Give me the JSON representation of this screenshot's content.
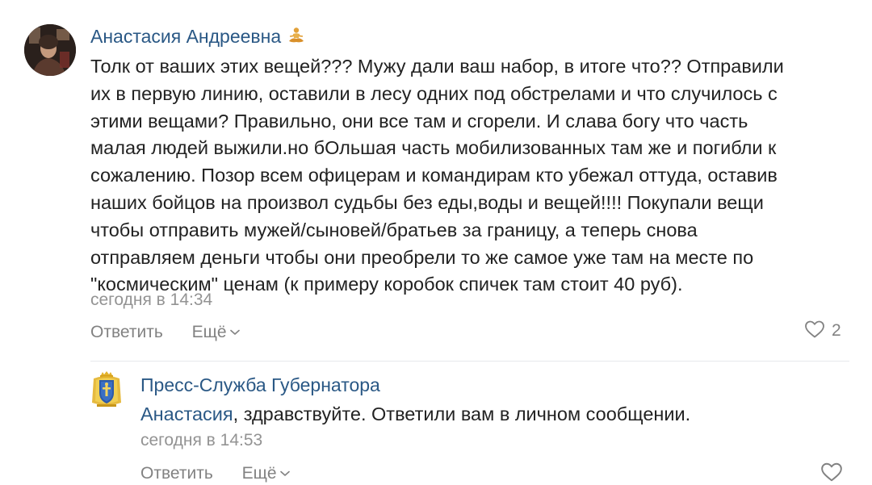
{
  "main_comment": {
    "author": "Анастасия Андреевна",
    "author_emoji": "🧘",
    "text_lines": [
      "Толк от ваших этих вещей??? Мужу дали ваш набор, в итоге что?? Отправили",
      "их в первую линию, оставили в лесу одних под обстрелами и что случилось с",
      "этими вещами? Правильно, они все там и сгорели. И слава богу что часть",
      "малая людей выжили.но бОльшая часть мобилизованных там же и погибли к",
      "сожалению. Позор всем офицерам и командирам кто убежал оттуда, оставив",
      "наших бойцов на произвол судьбы без еды,воды и вещей!!!! Покупали вещи",
      "чтобы отправить мужей/сыновей/братьев за границу, а теперь снова",
      "отправляем деньги чтобы они преобрели то же самое уже там на месте по",
      "\"космическим\" ценам (к примеру коробок спичек там стоит 40 руб)."
    ],
    "timestamp": "сегодня в 14:34",
    "reply_label": "Ответить",
    "more_label": "Ещё",
    "likes": "2",
    "icons": {
      "avatar": "user-avatar",
      "like": "heart-icon",
      "more": "chevron-down-icon"
    }
  },
  "reply_comment": {
    "author": "Пресс-Служба Губернатора",
    "mention": "Анастасия",
    "text": ", здравствуйте. Ответили вам в личном сообщении.",
    "timestamp": "сегодня в 14:53",
    "reply_label": "Ответить",
    "more_label": "Ещё",
    "icons": {
      "avatar": "coat-of-arms-avatar",
      "like": "heart-icon",
      "more": "chevron-down-icon"
    }
  },
  "colors": {
    "link": "#2a5885",
    "text": "#222222",
    "meta": "#939393",
    "action": "#828282"
  }
}
